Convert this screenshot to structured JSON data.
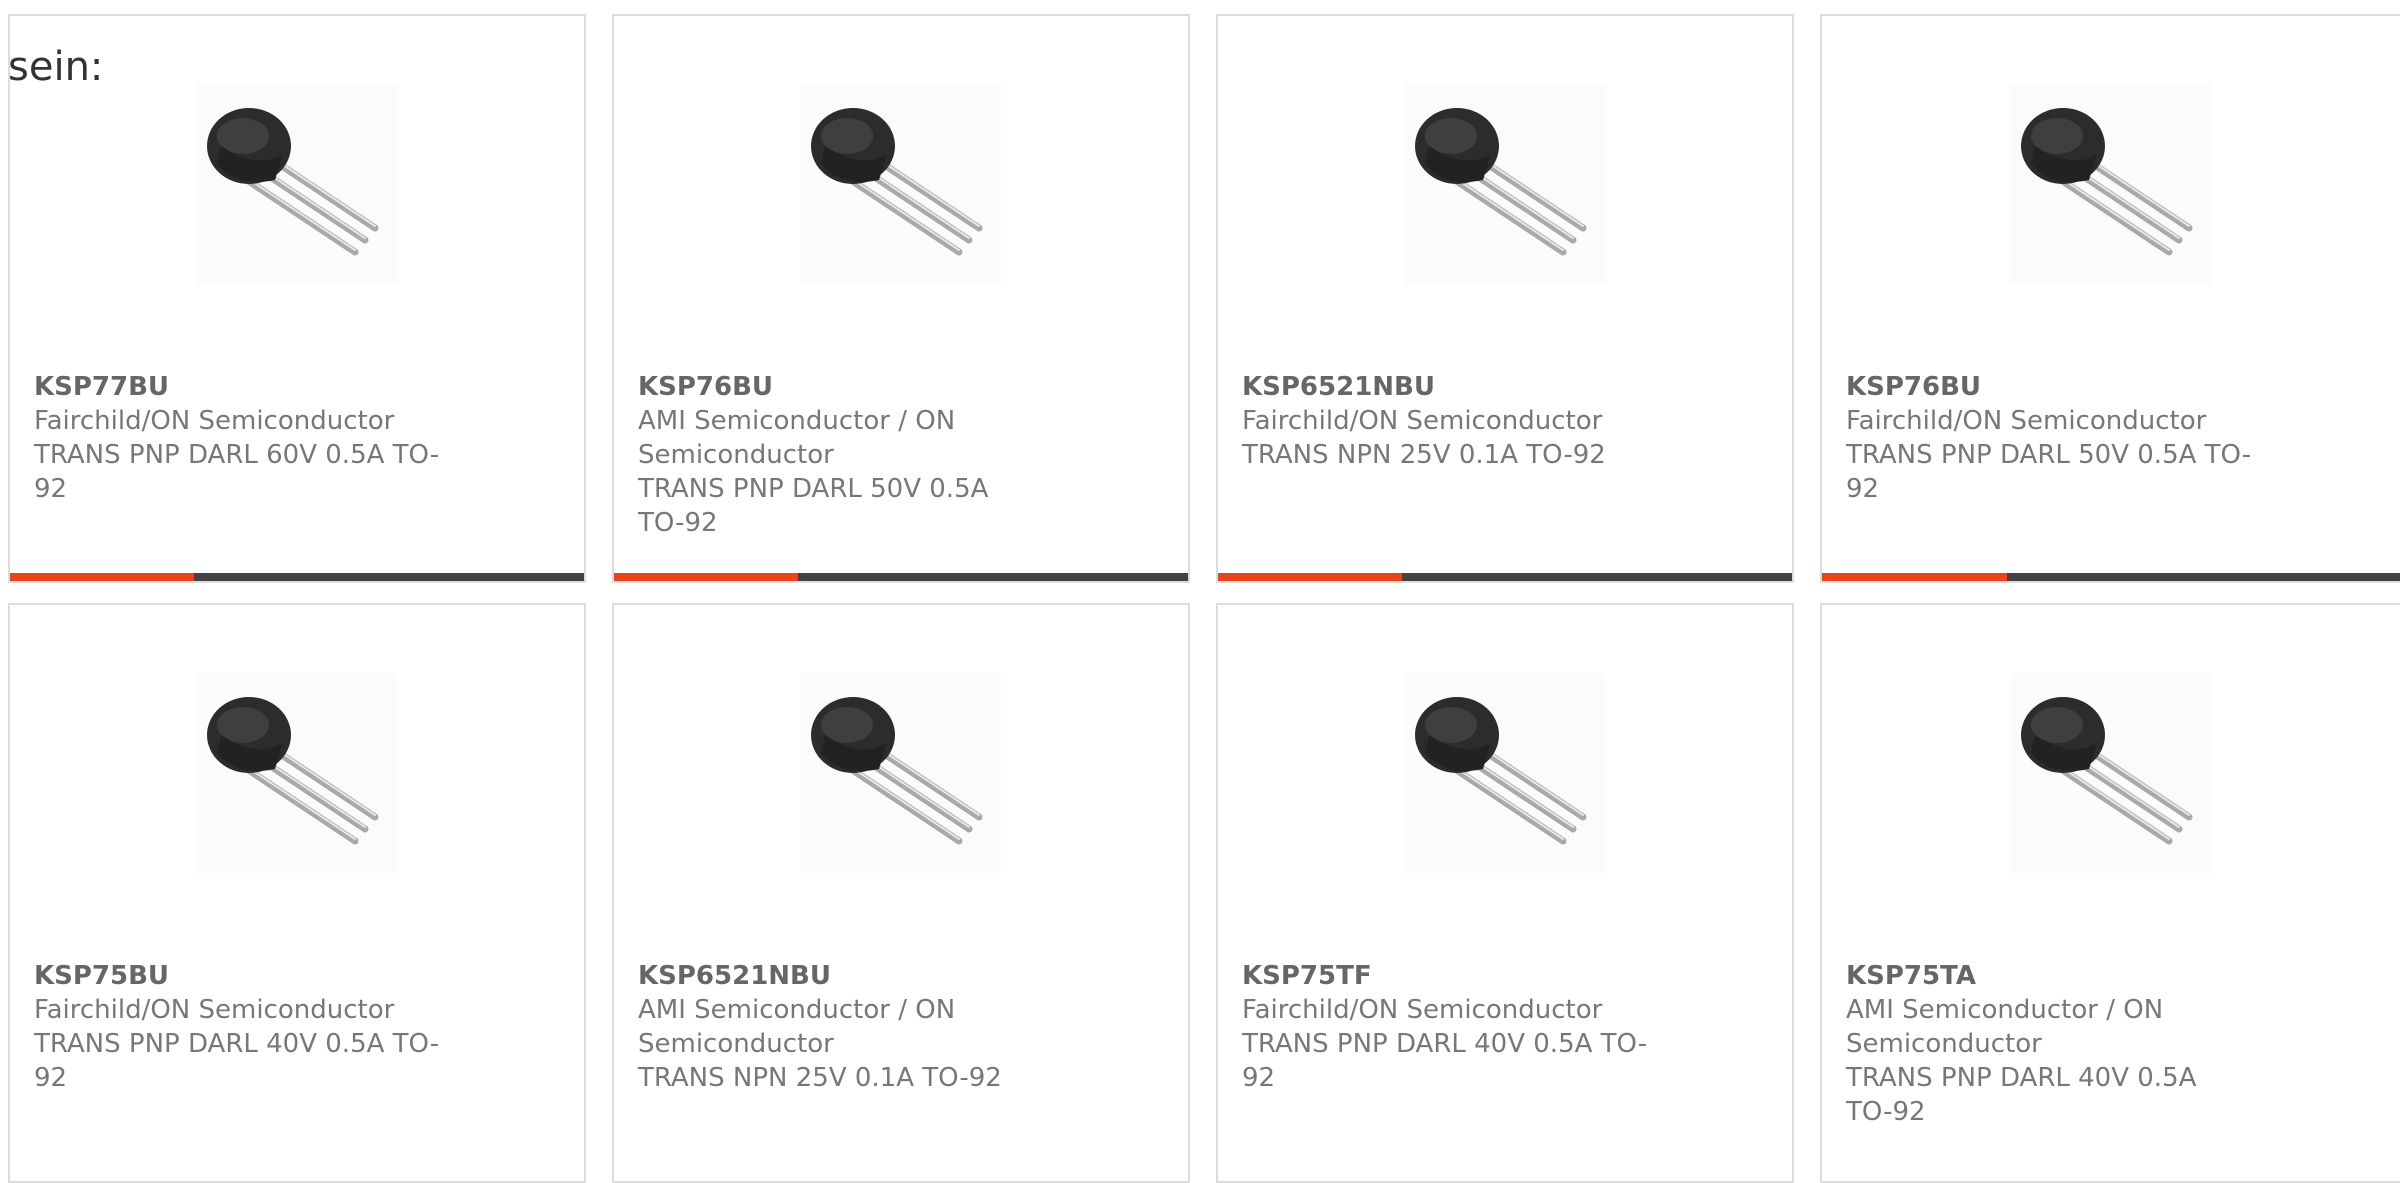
{
  "intro_text": "sein:",
  "colors": {
    "accent": "#e8461a",
    "bar": "#424242",
    "border": "#dcdcdc",
    "text": "#777777"
  },
  "cards": [
    {
      "part": "KSP77BU",
      "manufacturer": "Fairchild/ON Semiconductor",
      "desc": "TRANS PNP DARL 60V 0.5A TO-92",
      "image": "to92-transistor-icon",
      "progress": 0.32
    },
    {
      "part": "KSP76BU",
      "manufacturer": "AMI Semiconductor / ON Semiconductor",
      "desc": "TRANS PNP DARL 50V 0.5A TO-92",
      "image": "to92-transistor-icon",
      "progress": 0.32
    },
    {
      "part": "KSP6521NBU",
      "manufacturer": "Fairchild/ON Semiconductor",
      "desc": "TRANS NPN 25V 0.1A TO-92",
      "image": "to92-transistor-icon",
      "progress": 0.32
    },
    {
      "part": "KSP76BU",
      "manufacturer": "Fairchild/ON Semiconductor",
      "desc": "TRANS PNP DARL 50V 0.5A TO-92",
      "image": "to92-transistor-icon",
      "progress": 0.32
    },
    {
      "part": "KSP75BU",
      "manufacturer": "Fairchild/ON Semiconductor",
      "desc": "TRANS PNP DARL 40V 0.5A TO-92",
      "image": "to92-transistor-icon"
    },
    {
      "part": "KSP6521NBU",
      "manufacturer": "AMI Semiconductor / ON Semiconductor",
      "desc": "TRANS NPN 25V 0.1A TO-92",
      "image": "to92-transistor-icon"
    },
    {
      "part": "KSP75TF",
      "manufacturer": "Fairchild/ON Semiconductor",
      "desc": "TRANS PNP DARL 40V 0.5A TO-92",
      "image": "to92-transistor-icon"
    },
    {
      "part": "KSP75TA",
      "manufacturer": "AMI Semiconductor / ON Semiconductor",
      "desc": "TRANS PNP DARL 40V 0.5A TO-92",
      "image": "to92-transistor-icon"
    }
  ]
}
